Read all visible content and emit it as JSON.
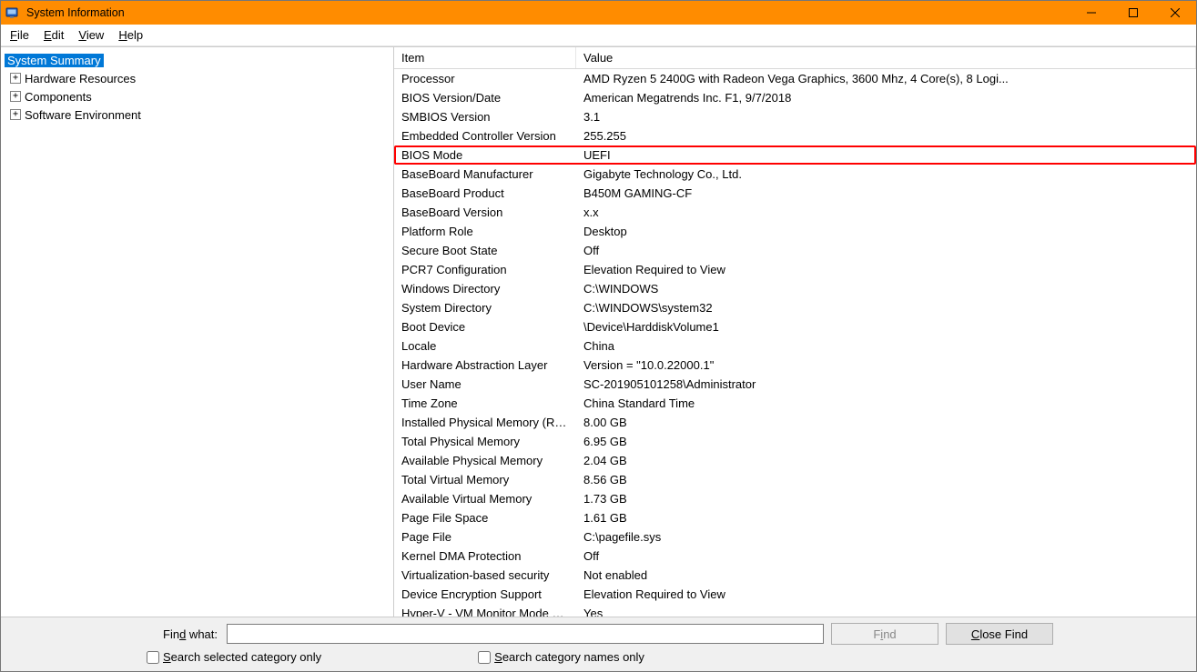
{
  "window": {
    "title": "System Information"
  },
  "menubar": {
    "file": "File",
    "edit": "Edit",
    "view": "View",
    "help": "Help"
  },
  "tree": {
    "root": "System Summary",
    "children": [
      "Hardware Resources",
      "Components",
      "Software Environment"
    ]
  },
  "columns": {
    "item": "Item",
    "value": "Value"
  },
  "rows": [
    {
      "item": "Processor",
      "value": "AMD Ryzen 5 2400G with Radeon Vega Graphics, 3600 Mhz, 4 Core(s), 8 Logi..."
    },
    {
      "item": "BIOS Version/Date",
      "value": "American Megatrends Inc. F1, 9/7/2018"
    },
    {
      "item": "SMBIOS Version",
      "value": "3.1"
    },
    {
      "item": "Embedded Controller Version",
      "value": "255.255"
    },
    {
      "item": "BIOS Mode",
      "value": "UEFI",
      "highlight": true
    },
    {
      "item": "BaseBoard Manufacturer",
      "value": "Gigabyte Technology Co., Ltd."
    },
    {
      "item": "BaseBoard Product",
      "value": "B450M GAMING-CF"
    },
    {
      "item": "BaseBoard Version",
      "value": "x.x"
    },
    {
      "item": "Platform Role",
      "value": "Desktop"
    },
    {
      "item": "Secure Boot State",
      "value": "Off"
    },
    {
      "item": "PCR7 Configuration",
      "value": "Elevation Required to View"
    },
    {
      "item": "Windows Directory",
      "value": "C:\\WINDOWS"
    },
    {
      "item": "System Directory",
      "value": "C:\\WINDOWS\\system32"
    },
    {
      "item": "Boot Device",
      "value": "\\Device\\HarddiskVolume1"
    },
    {
      "item": "Locale",
      "value": "China"
    },
    {
      "item": "Hardware Abstraction Layer",
      "value": "Version = \"10.0.22000.1\""
    },
    {
      "item": "User Name",
      "value": "SC-201905101258\\Administrator"
    },
    {
      "item": "Time Zone",
      "value": "China Standard Time"
    },
    {
      "item": "Installed Physical Memory (RAM)",
      "value": "8.00 GB"
    },
    {
      "item": "Total Physical Memory",
      "value": "6.95 GB"
    },
    {
      "item": "Available Physical Memory",
      "value": "2.04 GB"
    },
    {
      "item": "Total Virtual Memory",
      "value": "8.56 GB"
    },
    {
      "item": "Available Virtual Memory",
      "value": "1.73 GB"
    },
    {
      "item": "Page File Space",
      "value": "1.61 GB"
    },
    {
      "item": "Page File",
      "value": "C:\\pagefile.sys"
    },
    {
      "item": "Kernel DMA Protection",
      "value": "Off"
    },
    {
      "item": "Virtualization-based security",
      "value": "Not enabled"
    },
    {
      "item": "Device Encryption Support",
      "value": "Elevation Required to View"
    },
    {
      "item": "Hyper-V - VM Monitor Mode E...",
      "value": "Yes"
    }
  ],
  "footer": {
    "find_what_label": "Find what:",
    "find_value": "",
    "find_button": "Find",
    "close_find_button": "Close Find",
    "search_selected_label": "Search selected category only",
    "search_names_label": "Search category names only"
  }
}
